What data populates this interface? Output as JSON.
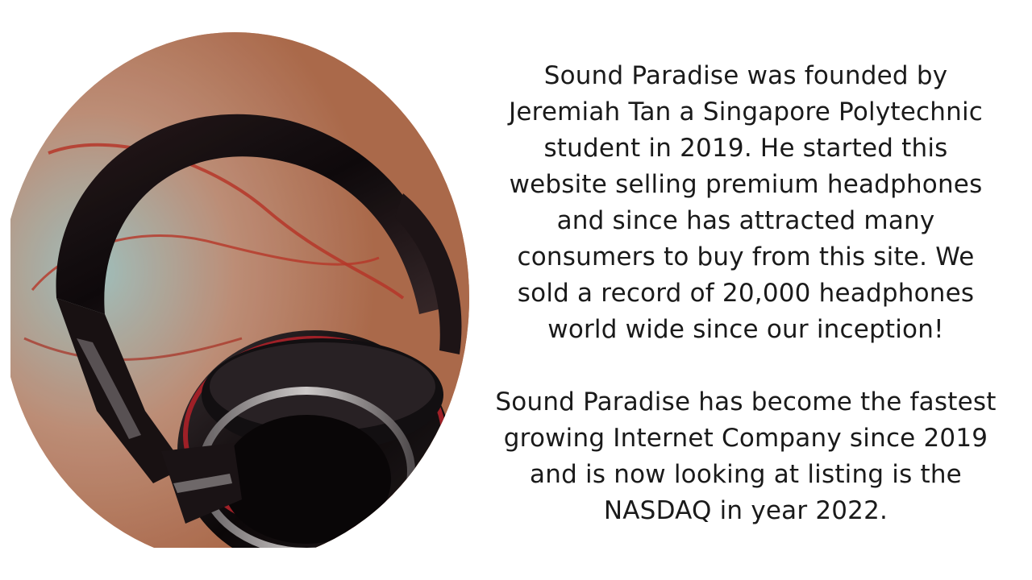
{
  "about": {
    "paragraph_1": "Sound Paradise was founded by Jeremiah Tan a Singapore Polytechnic student in 2019. He started this website selling premium headphones and since has attracted many consumers to buy from this site. We sold a record of 20,000 headphones world wide since our inception!",
    "paragraph_2": "Sound Paradise has become the fastest growing Internet Company since 2019 and is now looking at listing is the NASDAQ in year 2022."
  },
  "image": {
    "subject": "headphones-photo"
  },
  "colors": {
    "background": "#ffffff",
    "text": "#1a1a1a",
    "table_wood": "#c98964",
    "cable_red": "#c0392b"
  }
}
